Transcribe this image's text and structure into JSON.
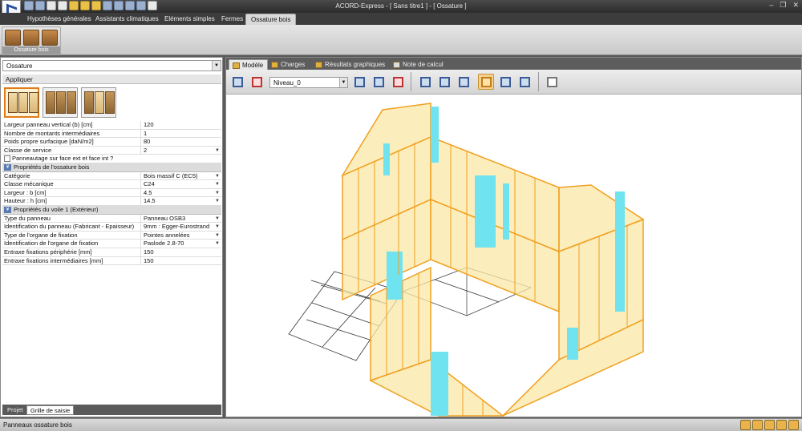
{
  "window": {
    "title": "ACORD-Express - [ Sans titre1 ] - [ Ossature ]",
    "controls": [
      "–",
      "❐",
      "✕"
    ]
  },
  "ribbon": {
    "tabs": [
      "Hypothèses générales",
      "Assistants climatiques",
      "Eléments simples",
      "Fermes",
      "Ossature bois"
    ],
    "active_tab": "Ossature bois",
    "group_label": "Ossature bois"
  },
  "left_panel": {
    "combo_value": "Ossature",
    "apply_label": "Appliquer",
    "properties": [
      {
        "label": "Largeur panneau vertical (b)  [cm]",
        "value": "120"
      },
      {
        "label": "Nombre de montants intermédiaires",
        "value": "1"
      },
      {
        "label": "Poids propre surfacique  [daN/m2]",
        "value": "80"
      },
      {
        "label": "Classe de service",
        "value": "2"
      }
    ],
    "checkbox_label": "Panneautage sur face ext et face int ?",
    "section_ossature": "Propriétés de l'ossature bois",
    "ossature_props": [
      {
        "label": "Catégorie",
        "value": "Bois massif C (EC5)"
      },
      {
        "label": "Classe mécanique",
        "value": "C24"
      },
      {
        "label": "Largeur : b  [cm]",
        "value": "4.5"
      },
      {
        "label": "Hauteur : h  [cm]",
        "value": "14.5"
      }
    ],
    "section_voile": "Propriétés du voile 1 (Extérieur)",
    "voile_props": [
      {
        "label": "Type du panneau",
        "value": "Panneau OSB3"
      },
      {
        "label": "Identification du panneau (Fabricant - Epaisseur)",
        "value": "9mm : Egger-Eurostrand"
      },
      {
        "label": "Type de l'organe de fixation",
        "value": "Pointes annelées"
      },
      {
        "label": "Identification de l'organe de fixation",
        "value": "Paslode 2.8-70"
      },
      {
        "label": "Entraxe fixations périphérie  [mm]",
        "value": "150"
      },
      {
        "label": "Entraxe fixations intermédiaires  [mm]",
        "value": "150"
      }
    ],
    "bottom_tabs": [
      "Projet",
      "Grille de saisie"
    ],
    "active_bottom_tab": "Grille de saisie"
  },
  "view": {
    "tabs": [
      "Modèle",
      "Charges",
      "Résultats graphiques",
      "Note de calcul"
    ],
    "active_tab": "Modèle",
    "level": "Niveau_0"
  },
  "status": {
    "text": "Panneaux ossature bois"
  },
  "colors": {
    "wall_fill": "#fbe7a6",
    "wall_edge": "#f0a020",
    "opening": "#6fe3ef",
    "accent": "#e07b1a"
  }
}
